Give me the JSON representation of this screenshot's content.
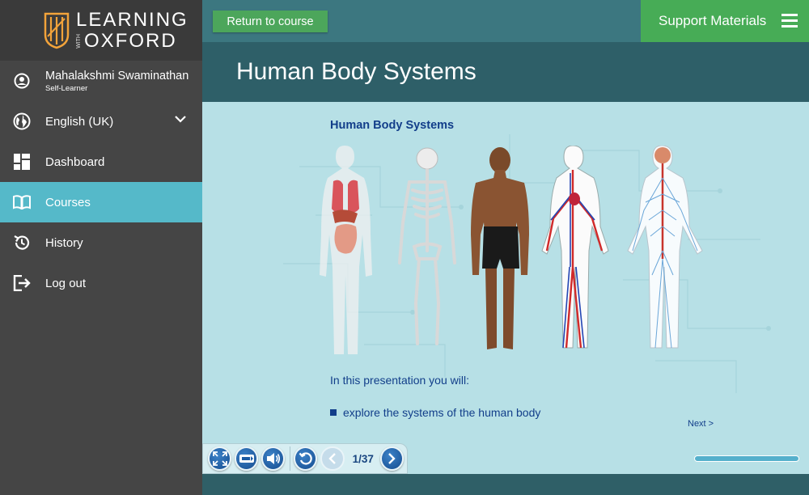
{
  "brand": {
    "line1": "LEARNING",
    "with": "WITH",
    "line2": "OXFORD",
    "colors": {
      "shield": "#f2a33a"
    }
  },
  "user": {
    "name": "Mahalakshmi Swaminathan",
    "role": "Self-Learner",
    "icon": "user-circle-icon"
  },
  "language": {
    "label": "English (UK)",
    "icon": "globe-icon"
  },
  "nav": {
    "dashboard": {
      "label": "Dashboard",
      "icon": "dashboard-icon"
    },
    "courses": {
      "label": "Courses",
      "icon": "book-icon",
      "active": true
    },
    "history": {
      "label": "History",
      "icon": "history-icon"
    },
    "logout": {
      "label": "Log out",
      "icon": "logout-icon"
    }
  },
  "topbar": {
    "return_label": "Return to course",
    "support_label": "Support Materials"
  },
  "page": {
    "title": "Human Body Systems"
  },
  "slide": {
    "title": "Human Body Systems",
    "intro": "In this presentation you will:",
    "bullet": "explore the systems of the human body",
    "next": "Next >"
  },
  "player": {
    "page_indicator": "1/37",
    "progress": 1.0
  },
  "colors": {
    "sidebar": "#454545",
    "active": "#55b9c9",
    "green": "#4ca65b",
    "title_band": "#2e5f68",
    "content": "#b7e0e6",
    "text_blue": "#123e8a"
  }
}
